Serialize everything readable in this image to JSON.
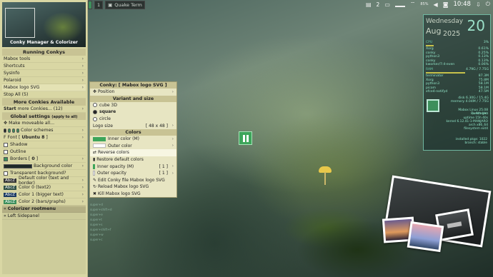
{
  "topbar": {
    "left_label": "Quake Term",
    "workspace": "1",
    "right": {
      "num": "2",
      "battery": "85%",
      "clock": "10:48",
      "icons": [
        "tray-icon",
        "wifi-icon",
        "speaker-icon",
        "camera-icon",
        "download-icon",
        "power-icon"
      ]
    }
  },
  "panel": {
    "banner_caption": "Conky Manager & Colorizer",
    "running_head": "Running Conkys",
    "running": [
      "Mabox tools",
      "Shortcuts",
      "SysInfo",
      "Polaroid",
      "Mabox logo SVG"
    ],
    "stop_all": "Stop All (5)",
    "more_head": "More Conkies Available",
    "start_more_label": "Start",
    "start_more_rest": "more Conkies... (12)",
    "global_head": "Global settings",
    "global_head_note": "(apply to all)",
    "make_moveable": "Make moveable all...",
    "color_schemes": "Color schemes",
    "font_label": "Font [",
    "font_name": "Ubuntu 8",
    "font_close": "]",
    "shadow": "Shadow",
    "outline": "Outline",
    "borders_label": "Borders [",
    "borders_val": "0",
    "borders_close": "]",
    "background_color": "Background color",
    "transparent_bg": "Transparent background?",
    "colors": [
      {
        "tag": "AbcZ",
        "label": "Default color (text and border)",
        "bg": "#333333"
      },
      {
        "tag": "AbcZ",
        "label": "Color 0 (text2)",
        "bg": "#2f4f44"
      },
      {
        "tag": "AbcZ",
        "label": "Color 1 (bigger text)",
        "bg": "#1c3b63"
      },
      {
        "tag": "AbcZ",
        "label": "Color 2 (bars/graphs)",
        "bg": "#3d8f5c"
      }
    ],
    "colorizer": "Colorizer rootmenu",
    "left_sidepanel": "Left Sidepanel"
  },
  "submenu": {
    "title": "Conky: [ Mabox logo SVG ]",
    "position": "Position",
    "variant_head": "Variant and size",
    "variants": [
      "cube 3D",
      "square",
      "circle"
    ],
    "selected_variant": "square",
    "logo_size_label": "Logo size",
    "logo_size_val": "[ 48 x 48 ]",
    "colors_head": "Colors",
    "inner_color": "Inner color (M)",
    "outer_color": "Outer color",
    "reverse_colors": "Reverse colors",
    "restore_default": "Restore default colors",
    "inner_opacity_label": "Inner opacity (M)",
    "inner_opacity_val": "[ 1 ]",
    "outer_opacity_label": "Outer opacity",
    "outer_opacity_val": "[ 1 ]",
    "edit_file": "Edit Conky file Mabox logo SVG",
    "reload": "Reload Mabox logo SVG",
    "kill": "Kill Mabox logo SVG",
    "inner_swatch": "#3da55a",
    "outer_swatch": "#ffffff"
  },
  "conky": {
    "day": "Wednesday",
    "month": "Aug",
    "year": "2025",
    "date": "20",
    "cpu_label": "CPU",
    "cpu_val": "3%",
    "procs": [
      {
        "name": "Xorg",
        "val": "0.61%"
      },
      {
        "name": "conky",
        "val": "0.25%"
      },
      {
        "name": "python3",
        "val": "0.13%"
      },
      {
        "name": "conky",
        "val": "0.13%"
      },
      {
        "name": "kworker/7:4-even",
        "val": "0.06%"
      }
    ],
    "ram_label": "RAM",
    "ram_val": "4.79G / 7.75G",
    "mem": [
      {
        "name": "terminator",
        "val": "87.3M"
      },
      {
        "name": "Xorg",
        "val": "75.8M"
      },
      {
        "name": "python3",
        "val": "58.1M"
      },
      {
        "name": "picom",
        "val": "58.1M"
      },
      {
        "name": "xfce4-notifyd",
        "val": "47.5M"
      }
    ],
    "disk_line1": "disk 6.30G / 15.4G",
    "disk_line2": "memory 4.04M / 7.75G",
    "sysinfo": [
      "Mabox Linux 25.08 (unstable)",
      "8x 4th-gen",
      "uptime 15h 40s",
      "kernel 6.12.41-1-MANJARO",
      "arch x86_64",
      "filesystem ext4"
    ],
    "foot1": "installed pkgs: 1022",
    "foot2": "branch: stable"
  },
  "tiny_menu": [
    "super+d",
    "super+shift+d",
    "super+e",
    "super+t",
    "super+s",
    "super+shift+f",
    "super+w",
    "super+c"
  ],
  "colors": {
    "accent": "#3d8f5c",
    "panel_bg": "#d9d7a4",
    "conky_text": "#8fe0c4"
  }
}
